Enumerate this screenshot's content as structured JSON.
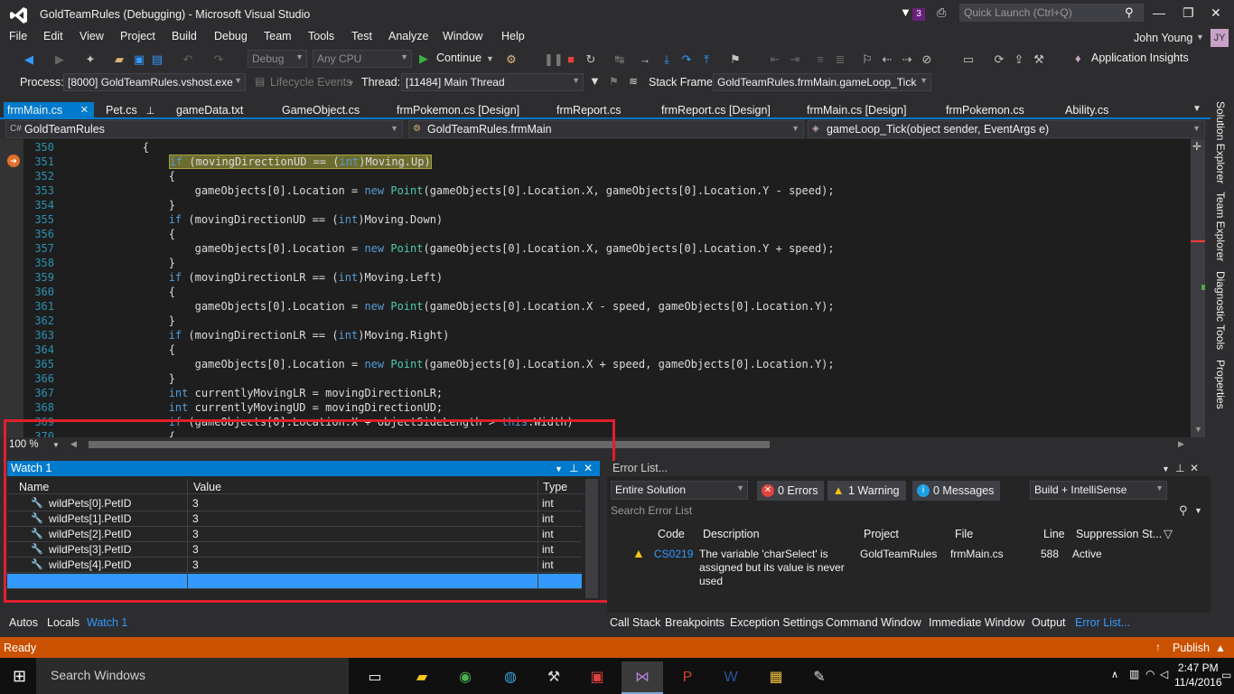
{
  "window": {
    "title": "GoldTeamRules (Debugging) - Microsoft Visual Studio",
    "notif_count": "3",
    "quick_launch_placeholder": "Quick Launch (Ctrl+Q)"
  },
  "menu": {
    "items": [
      "File",
      "Edit",
      "View",
      "Project",
      "Build",
      "Debug",
      "Team",
      "Tools",
      "Test",
      "Analyze",
      "Window",
      "Help"
    ],
    "user": "John Young",
    "avatar_initials": "JY"
  },
  "toolbar": {
    "config": "Debug",
    "platform": "Any CPU",
    "continue": "Continue",
    "app_insights": "Application Insights"
  },
  "debugbar": {
    "process_label": "Process:",
    "process_value": "[8000] GoldTeamRules.vshost.exe",
    "lifecycle": "Lifecycle Events",
    "thread_label": "Thread:",
    "thread_value": "[11484] Main Thread",
    "stack_label": "Stack Frame:",
    "stack_value": "GoldTeamRules.frmMain.gameLoop_Tick"
  },
  "tabs": [
    "frmMain.cs",
    "Pet.cs",
    "gameData.txt",
    "GameObject.cs",
    "frmPokemon.cs [Design]",
    "frmReport.cs",
    "frmReport.cs [Design]",
    "frmMain.cs [Design]",
    "frmPokemon.cs",
    "Ability.cs"
  ],
  "navbar": {
    "project": "GoldTeamRules",
    "class": "GoldTeamRules.frmMain",
    "member": "gameLoop_Tick(object sender, EventArgs e)"
  },
  "code": [
    {
      "n": "350",
      "t": "        {"
    },
    {
      "n": "351",
      "t": "            if (movingDirectionUD == (int)Moving.Up)"
    },
    {
      "n": "352",
      "t": "            {"
    },
    {
      "n": "353",
      "t": "                gameObjects[0].Location = new Point(gameObjects[0].Location.X, gameObjects[0].Location.Y - speed);"
    },
    {
      "n": "354",
      "t": "            }"
    },
    {
      "n": "355",
      "t": "            if (movingDirectionUD == (int)Moving.Down)"
    },
    {
      "n": "356",
      "t": "            {"
    },
    {
      "n": "357",
      "t": "                gameObjects[0].Location = new Point(gameObjects[0].Location.X, gameObjects[0].Location.Y + speed);"
    },
    {
      "n": "358",
      "t": "            }"
    },
    {
      "n": "359",
      "t": "            if (movingDirectionLR == (int)Moving.Left)"
    },
    {
      "n": "360",
      "t": "            {"
    },
    {
      "n": "361",
      "t": "                gameObjects[0].Location = new Point(gameObjects[0].Location.X - speed, gameObjects[0].Location.Y);"
    },
    {
      "n": "362",
      "t": "            }"
    },
    {
      "n": "363",
      "t": "            if (movingDirectionLR == (int)Moving.Right)"
    },
    {
      "n": "364",
      "t": "            {"
    },
    {
      "n": "365",
      "t": "                gameObjects[0].Location = new Point(gameObjects[0].Location.X + speed, gameObjects[0].Location.Y);"
    },
    {
      "n": "366",
      "t": "            }"
    },
    {
      "n": "367",
      "t": "            int currentlyMovingLR = movingDirectionLR;"
    },
    {
      "n": "368",
      "t": "            int currentlyMovingUD = movingDirectionUD;"
    },
    {
      "n": "369",
      "t": "            if (gameObjects[0].Location.X + objectSideLength > this.Width)"
    },
    {
      "n": "370",
      "t": "            {"
    }
  ],
  "editor": {
    "zoom": "100 %"
  },
  "side_tabs": [
    "Solution Explorer",
    "Team Explorer",
    "Diagnostic Tools",
    "Properties"
  ],
  "watch": {
    "title": "Watch 1",
    "columns": [
      "Name",
      "Value",
      "Type"
    ],
    "rows": [
      {
        "name": "wildPets[0].PetID",
        "value": "3",
        "type": "int"
      },
      {
        "name": "wildPets[1].PetID",
        "value": "3",
        "type": "int"
      },
      {
        "name": "wildPets[2].PetID",
        "value": "3",
        "type": "int"
      },
      {
        "name": "wildPets[3].PetID",
        "value": "3",
        "type": "int"
      },
      {
        "name": "wildPets[4].PetID",
        "value": "3",
        "type": "int"
      }
    ]
  },
  "errors": {
    "title": "Error List...",
    "scope": "Entire Solution",
    "errors_btn": "0 Errors",
    "warnings_btn": "1 Warning",
    "messages_btn": "0 Messages",
    "filter": "Build + IntelliSense",
    "search_placeholder": "Search Error List",
    "columns": [
      "Code",
      "Description",
      "Project",
      "File",
      "Line",
      "Suppression St..."
    ],
    "row": {
      "code": "CS0219",
      "description": "The variable 'charSelect' is assigned but its value is never used",
      "project": "GoldTeamRules",
      "file": "frmMain.cs",
      "line": "588",
      "suppression": "Active"
    }
  },
  "bottom_tabs_left": [
    "Autos",
    "Locals",
    "Watch 1"
  ],
  "bottom_tabs_right": [
    "Call Stack",
    "Breakpoints",
    "Exception Settings",
    "Command Window",
    "Immediate Window",
    "Output",
    "Error List..."
  ],
  "status": {
    "text": "Ready",
    "publish": "Publish"
  },
  "taskbar": {
    "search": "Search Windows",
    "time": "2:47 PM",
    "date": "11/4/2016"
  },
  "colors": {
    "accent": "#007acc",
    "status": "#ca5100",
    "highlight_box": "#e0202c"
  }
}
